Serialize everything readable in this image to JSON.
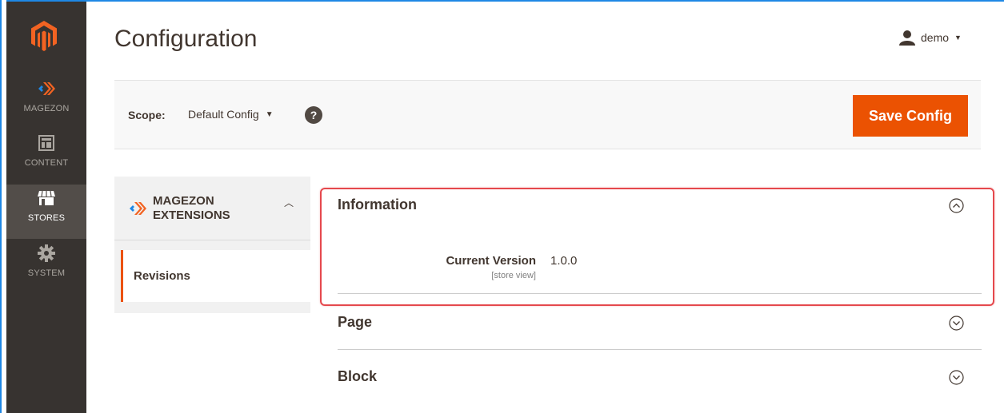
{
  "colors": {
    "accent": "#eb5202",
    "nav_bg": "#373330",
    "nav_active": "#524d49",
    "highlight": "#e5484d",
    "frame": "#1e88e5"
  },
  "nav": {
    "logo_icon": "magento-logo-icon",
    "items": [
      {
        "label": "MAGEZON",
        "icon": "magezon-icon",
        "active": false
      },
      {
        "label": "CONTENT",
        "icon": "content-layout-icon",
        "active": false
      },
      {
        "label": "STORES",
        "icon": "stores-shop-icon",
        "active": true
      },
      {
        "label": "SYSTEM",
        "icon": "gear-icon",
        "active": false
      }
    ]
  },
  "header": {
    "title": "Configuration",
    "user": "demo"
  },
  "actions": {
    "scope_label": "Scope:",
    "scope_value": "Default Config",
    "help": "?",
    "save_label": "Save Config"
  },
  "tabs": {
    "group_title": "MAGEZON EXTENSIONS",
    "group_title_line1": "MAGEZON",
    "group_title_line2": "EXTENSIONS",
    "items": [
      {
        "label": "Revisions",
        "active": true
      }
    ]
  },
  "sections": {
    "information": {
      "title": "Information",
      "expanded": true,
      "fields": [
        {
          "label": "Current Version",
          "scope": "[store view]",
          "value": "1.0.0"
        }
      ]
    },
    "page": {
      "title": "Page",
      "expanded": false
    },
    "block": {
      "title": "Block",
      "expanded": false
    }
  }
}
